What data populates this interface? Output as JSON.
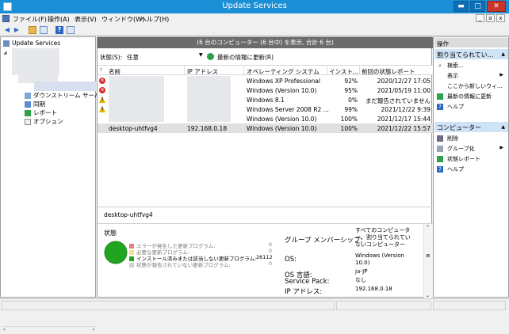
{
  "window": {
    "title": "Update Services",
    "controls": {
      "minimize": "▬",
      "maximize": "□",
      "close": "✕"
    }
  },
  "menu": {
    "items": [
      "ファイル(F)",
      "操作(A)",
      "表示(V)",
      "ウィンドウ(W)",
      "ヘルプ(H)"
    ],
    "mdi_controls": [
      "_",
      "ɑ",
      "x"
    ]
  },
  "toolbar": {
    "icons": [
      "back-arrow-icon",
      "forward-arrow-icon",
      "folder-icon",
      "console-tree-icon",
      "help-icon",
      "view-icon"
    ]
  },
  "tree": {
    "root": "Update Services",
    "items": [
      "ダウンストリーム サーバー",
      "同期",
      "レポート",
      "オプション"
    ]
  },
  "center": {
    "header": "(6 台のコンピューター (6 台中) を表示, 合計 6 台)",
    "status_label": "状態(S):",
    "status_value": "任意",
    "refresh_label": "最新の情報に更新(R)",
    "columns": [
      "名前",
      "IP アドレス",
      "オペレーティング システム",
      "インスト...",
      "前回の状態レポート"
    ],
    "rows": [
      {
        "status": "error",
        "name": "",
        "ip": "",
        "os": "Windows XP Professional",
        "installed": "92%",
        "report": "2020/12/27 17:05"
      },
      {
        "status": "error",
        "name": "",
        "ip": "",
        "os": "Windows (Version 10.0)",
        "installed": "95%",
        "report": "2021/05/19 11:00"
      },
      {
        "status": "warning",
        "name": "",
        "ip": "",
        "os": "Windows 8.1",
        "installed": "0%",
        "report": "まだ報告されていません"
      },
      {
        "status": "warning",
        "name": "",
        "ip": "",
        "os": "Windows Server 2008 R2 ...",
        "installed": "99%",
        "report": "2021/12/22 9:39"
      },
      {
        "status": "none",
        "name": "",
        "ip": "",
        "os": "Windows (Version 10.0)",
        "installed": "100%",
        "report": "2021/12/17 15:44"
      },
      {
        "status": "none",
        "name": "desktop-uhtfvg4",
        "ip": "192.168.0.18",
        "os": "Windows (Version 10.0)",
        "installed": "100%",
        "report": "2021/12/22 15:57",
        "selected": true
      }
    ],
    "selected_name": "desktop-uhtfvg4",
    "detail": {
      "status_title": "状態",
      "status_fraction_ok": 1.0,
      "legend": [
        {
          "label": "エラーが発生した更新プログラム:",
          "value": "0",
          "color": "#e08080"
        },
        {
          "label": "必要な更新プログラム:",
          "value": "0",
          "color": "#f3e08a"
        },
        {
          "label": "インストール済みまたは該当しない更新プログラム:",
          "value": "26112",
          "color": "#21a521"
        },
        {
          "label": "状態が報告されていない更新プログラム:",
          "value": "0",
          "color": "#d0d0d0"
        }
      ],
      "props": [
        {
          "key": "グループ メンバーシップ:",
          "value": "すべてのコンピューター、割り当てられていないコンピューター"
        },
        {
          "key": "OS:",
          "value": "Windows (Version 10.0)"
        },
        {
          "key": "OS 言語:",
          "value": "ja-JP"
        },
        {
          "key": "Service Pack:",
          "value": "なし"
        },
        {
          "key": "IP アドレス:",
          "value": "192.168.0.18"
        }
      ]
    }
  },
  "actions": {
    "header": "操作",
    "section1": "割り当てられてい...",
    "section1_items": [
      "検索...",
      "表示",
      "ここから新しいウィ...",
      "最新の情報に更新",
      "ヘルプ"
    ],
    "section2": "コンピューター",
    "section2_items": [
      "削除",
      "グループ化",
      "状態レポート",
      "ヘルプ"
    ]
  },
  "colors": {
    "titlebar": "#1b8fd6",
    "header_gray": "#6b6b6b",
    "action_section": "#cfe3f7",
    "ok_green": "#21a521"
  }
}
